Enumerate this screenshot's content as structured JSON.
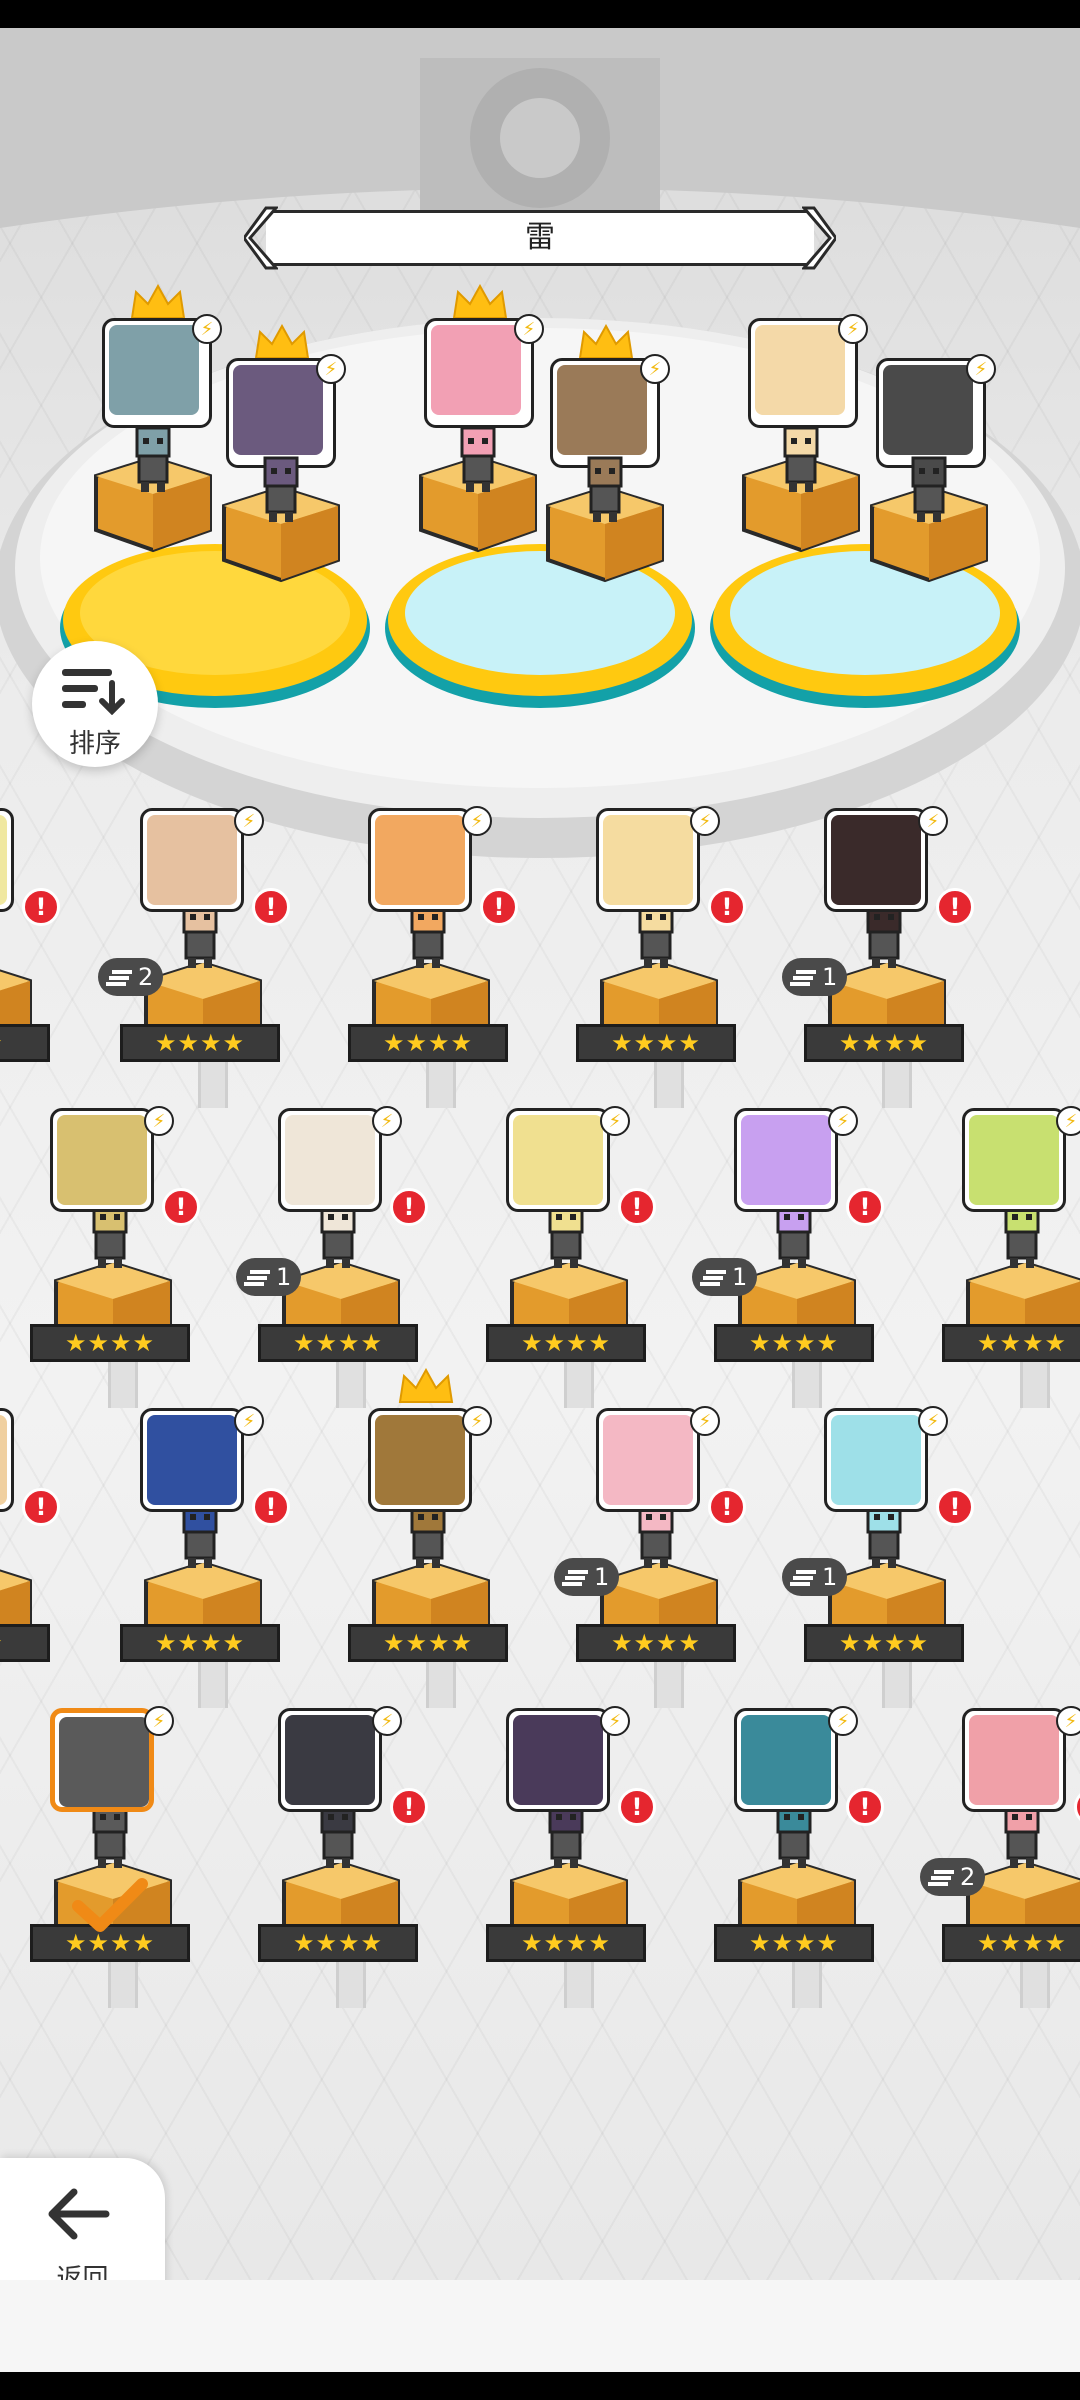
{
  "header": {
    "element_title": "雷"
  },
  "controls": {
    "sort_label": "排序",
    "back_label": "返回"
  },
  "colors": {
    "gold": "#ffcb1f",
    "alert": "#e5262f",
    "selected": "#f08a16",
    "pedestal": "#f2b84a"
  },
  "icons": [
    "chevron-left-icon",
    "chevron-right-icon",
    "sort-icon",
    "back-arrow-icon",
    "lightning-icon",
    "crown-icon",
    "alert-icon",
    "stack-icon",
    "checkmark-icon"
  ],
  "top_team": [
    {
      "name": "slot-1",
      "face": "#7fa0a8",
      "crown": true
    },
    {
      "name": "slot-2",
      "face": "#6b5a7e",
      "crown": true
    },
    {
      "name": "slot-3",
      "face": "#f2a0b4",
      "crown": true
    },
    {
      "name": "slot-4",
      "face": "#9a7a58",
      "crown": true
    },
    {
      "name": "slot-5",
      "face": "#f4d9a8",
      "crown": false
    },
    {
      "name": "slot-6",
      "face": "#4a4a4a",
      "crown": false
    }
  ],
  "heroes": [
    {
      "stars": "★★★★",
      "alert": "!",
      "face": "#e6c1a0",
      "badge": "2",
      "crown": false,
      "selected": false,
      "check": false
    },
    {
      "stars": "★★★★",
      "alert": "!",
      "face": "#f2a860",
      "badge": "",
      "crown": false,
      "selected": false,
      "check": false
    },
    {
      "stars": "★★★★",
      "alert": "!",
      "face": "#f5dca0",
      "badge": "",
      "crown": false,
      "selected": false,
      "check": false
    },
    {
      "stars": "★★★★",
      "alert": "!",
      "face": "#3a2a2a",
      "badge": "1",
      "crown": false,
      "selected": false,
      "check": false
    },
    {
      "stars": "★★★★",
      "alert": "!",
      "face": "#d8c070",
      "badge": "",
      "crown": false,
      "selected": false,
      "check": false
    },
    {
      "stars": "★★★★",
      "alert": "!",
      "face": "#efe6d8",
      "badge": "1",
      "crown": false,
      "selected": false,
      "check": false
    },
    {
      "stars": "★★★★",
      "alert": "!",
      "face": "#f0e090",
      "badge": "",
      "crown": false,
      "selected": false,
      "check": false
    },
    {
      "stars": "★★★★",
      "alert": "!",
      "face": "#c8a0f0",
      "badge": "1",
      "crown": false,
      "selected": false,
      "check": false
    },
    {
      "stars": "★★★★",
      "alert": "",
      "face": "#c8e070",
      "badge": "",
      "crown": false,
      "selected": false,
      "check": false
    },
    {
      "stars": "★★★★",
      "alert": "!",
      "face": "#3050a0",
      "badge": "",
      "crown": false,
      "selected": false,
      "check": false
    },
    {
      "stars": "★★★★",
      "alert": "",
      "face": "#a0783a",
      "badge": "",
      "crown": true,
      "selected": false,
      "check": false
    },
    {
      "stars": "★★★★",
      "alert": "!",
      "face": "#f4b8c4",
      "badge": "1",
      "crown": false,
      "selected": false,
      "check": false
    },
    {
      "stars": "★★★★",
      "alert": "!",
      "face": "#9ee0e8",
      "badge": "1",
      "crown": false,
      "selected": false,
      "check": false
    },
    {
      "stars": "★★★★",
      "alert": "",
      "face": "#5a5a5a",
      "badge": "",
      "crown": false,
      "selected": true,
      "check": true
    },
    {
      "stars": "★★★★",
      "alert": "!",
      "face": "#3a3a42",
      "badge": "",
      "crown": false,
      "selected": false,
      "check": false
    },
    {
      "stars": "★★★★",
      "alert": "!",
      "face": "#4a3a5a",
      "badge": "",
      "crown": false,
      "selected": false,
      "check": false
    },
    {
      "stars": "★★★★",
      "alert": "!",
      "face": "#3a8a9a",
      "badge": "",
      "crown": false,
      "selected": false,
      "check": false
    },
    {
      "stars": "★★★★",
      "alert": "!",
      "face": "#f0a0a8",
      "badge": "2",
      "crown": false,
      "selected": false,
      "check": false
    }
  ],
  "edge_heroes": [
    {
      "stars": "★★★",
      "alert": "!",
      "face": "#f0e8a0"
    },
    {
      "stars": "★★★",
      "alert": "!",
      "face": "#f0d0a0"
    }
  ]
}
